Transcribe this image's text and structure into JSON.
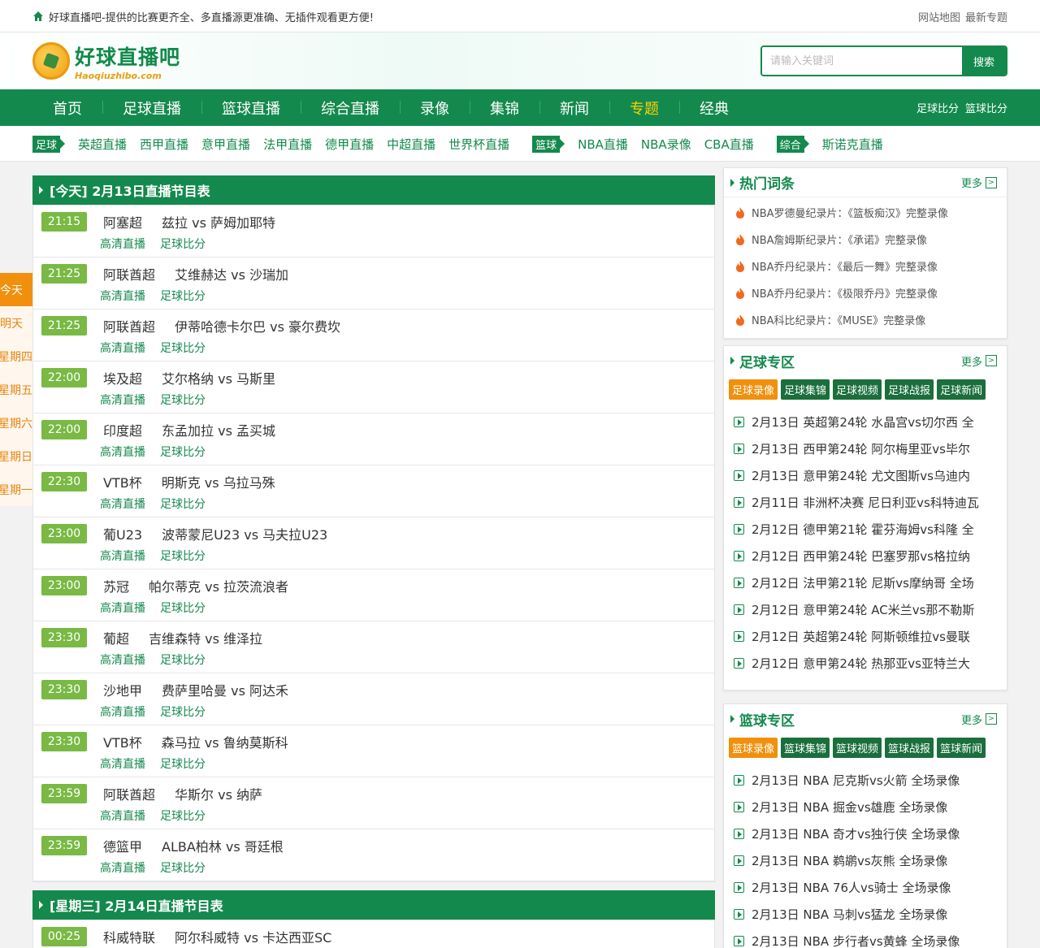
{
  "topbar": {
    "slogan": "好球直播吧-提供的比赛更齐全、多直播源更准确、无插件观看更方便!",
    "links": [
      "网站地图",
      "最新专题"
    ]
  },
  "logo": {
    "cn": "好球直播吧",
    "en": "Haoqiuzhibo.com"
  },
  "search": {
    "placeholder": "请输入关键词",
    "button": "搜索"
  },
  "nav": {
    "items": [
      "首页",
      "足球直播",
      "篮球直播",
      "综合直播",
      "录像",
      "集锦",
      "新闻",
      "专题",
      "经典"
    ],
    "active_index": 7,
    "right": [
      "足球比分",
      "篮球比分"
    ]
  },
  "subnav": {
    "football_tag": "足球",
    "football": [
      "英超直播",
      "西甲直播",
      "意甲直播",
      "法甲直播",
      "德甲直播",
      "中超直播",
      "世界杯直播"
    ],
    "basketball_tag": "篮球",
    "basketball": [
      "NBA直播",
      "NBA录像",
      "CBA直播"
    ],
    "other_tag": "综合",
    "other": [
      "斯诺克直播"
    ]
  },
  "daytabs": [
    "今天",
    "明天",
    "星期四",
    "星期五",
    "星期六",
    "星期日",
    "星期一"
  ],
  "schedule": [
    {
      "title": "[今天] 2月13日直播节目表",
      "matches": [
        {
          "time": "21:15",
          "league": "阿塞超",
          "teams": "兹拉 vs 萨姆加耶特"
        },
        {
          "time": "21:25",
          "league": "阿联酋超",
          "teams": "艾维赫达 vs 沙瑞加"
        },
        {
          "time": "21:25",
          "league": "阿联酋超",
          "teams": "伊蒂哈德卡尔巴 vs 豪尔费坎"
        },
        {
          "time": "22:00",
          "league": "埃及超",
          "teams": "艾尔格纳 vs 马斯里"
        },
        {
          "time": "22:00",
          "league": "印度超",
          "teams": "东孟加拉 vs 孟买城"
        },
        {
          "time": "22:30",
          "league": "VTB杯",
          "teams": "明斯克 vs 乌拉马殊"
        },
        {
          "time": "23:00",
          "league": "葡U23",
          "teams": "波蒂蒙尼U23 vs 马夫拉U23"
        },
        {
          "time": "23:00",
          "league": "苏冠",
          "teams": "帕尔蒂克 vs 拉茨流浪者"
        },
        {
          "time": "23:30",
          "league": "葡超",
          "teams": "吉维森特 vs 维泽拉"
        },
        {
          "time": "23:30",
          "league": "沙地甲",
          "teams": "费萨里哈曼 vs 阿达禾"
        },
        {
          "time": "23:30",
          "league": "VTB杯",
          "teams": "森马拉 vs 鲁纳莫斯科"
        },
        {
          "time": "23:59",
          "league": "阿联酋超",
          "teams": "华斯尔 vs 纳萨"
        },
        {
          "time": "23:59",
          "league": "德篮甲",
          "teams": "ALBA柏林 vs 哥廷根"
        }
      ],
      "link1": "高清直播",
      "link2": "足球比分"
    },
    {
      "title": "[星期三] 2月14日直播节目表",
      "matches": [
        {
          "time": "00:25",
          "league": "科威特联",
          "teams": "阿尔科威特 vs 卡达西亚SC"
        }
      ]
    }
  ],
  "hot": {
    "title": "热门词条",
    "more": "更多",
    "items": [
      "NBA罗德曼纪录片：《篮板痴汉》完整录像",
      "NBA詹姆斯纪录片：《承诺》完整录像",
      "NBA乔丹纪录片：《最后一舞》完整录像",
      "NBA乔丹纪录片：《极限乔丹》完整录像",
      "NBA科比纪录片：《MUSE》完整录像"
    ]
  },
  "football_zone": {
    "title": "足球专区",
    "more": "更多",
    "tabs": [
      "足球录像",
      "足球集锦",
      "足球视频",
      "足球战报",
      "足球新闻"
    ],
    "items": [
      "2月13日 英超第24轮 水晶宫vs切尔西 全",
      "2月13日 西甲第24轮 阿尔梅里亚vs毕尔",
      "2月13日 意甲第24轮 尤文图斯vs乌迪内",
      "2月11日 非洲杯决赛 尼日利亚vs科特迪瓦",
      "2月12日 德甲第21轮 霍芬海姆vs科隆 全",
      "2月12日 西甲第24轮 巴塞罗那vs格拉纳",
      "2月12日 法甲第21轮 尼斯vs摩纳哥 全场",
      "2月12日 意甲第24轮 AC米兰vs那不勒斯",
      "2月12日 英超第24轮 阿斯顿维拉vs曼联",
      "2月12日 意甲第24轮 热那亚vs亚特兰大"
    ]
  },
  "basketball_zone": {
    "title": "篮球专区",
    "more": "更多",
    "tabs": [
      "篮球录像",
      "篮球集锦",
      "篮球视频",
      "篮球战报",
      "篮球新闻"
    ],
    "items": [
      "2月13日 NBA 尼克斯vs火箭 全场录像",
      "2月13日 NBA 掘金vs雄鹿 全场录像",
      "2月13日 NBA 奇才vs独行侠 全场录像",
      "2月13日 NBA 鹈鹕vs灰熊 全场录像",
      "2月13日 NBA 76人vs骑士 全场录像",
      "2月13日 NBA 马刺vs猛龙 全场录像",
      "2月13日 NBA 步行者vs黄蜂 全场录像"
    ]
  }
}
